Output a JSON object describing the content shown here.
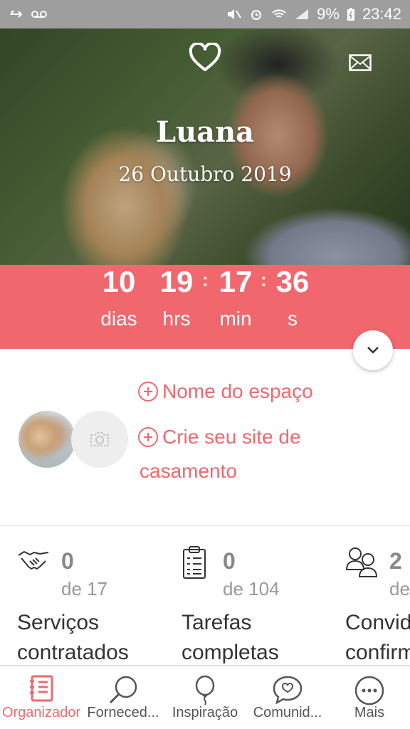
{
  "status_bar": {
    "battery": "9%",
    "time": "23:42"
  },
  "hero": {
    "name": "Luana",
    "date": "26 Outubro 2019"
  },
  "countdown": [
    {
      "value": "10",
      "label": "dias"
    },
    {
      "value": "19",
      "label": "hrs"
    },
    {
      "value": "17",
      "label": "min"
    },
    {
      "value": "36",
      "label": "s"
    }
  ],
  "links": {
    "venue": "Nome do espaço",
    "site_line1": "Crie seu site de",
    "site_line2": "casamento"
  },
  "stats": [
    {
      "count": "0",
      "of": "de 17",
      "label1": "Serviços",
      "label2": "contratados",
      "icon": "handshake-icon"
    },
    {
      "count": "0",
      "of": "de 104",
      "label1": "Tarefas",
      "label2": "completas",
      "icon": "clipboard-icon"
    },
    {
      "count": "2",
      "of": "de",
      "label1": "Convid",
      "label2": "confirm",
      "icon": "guests-icon"
    }
  ],
  "nav": [
    {
      "label": "Organizador",
      "icon": "notebook-icon",
      "active": true
    },
    {
      "label": "Forneced...",
      "icon": "search-icon"
    },
    {
      "label": "Inspiração",
      "icon": "balloon-icon"
    },
    {
      "label": "Comunid...",
      "icon": "chat-heart-icon"
    },
    {
      "label": "Mais",
      "icon": "more-icon"
    }
  ],
  "colors": {
    "accent": "#f0686e",
    "status_bar": "#9e9e9e"
  }
}
